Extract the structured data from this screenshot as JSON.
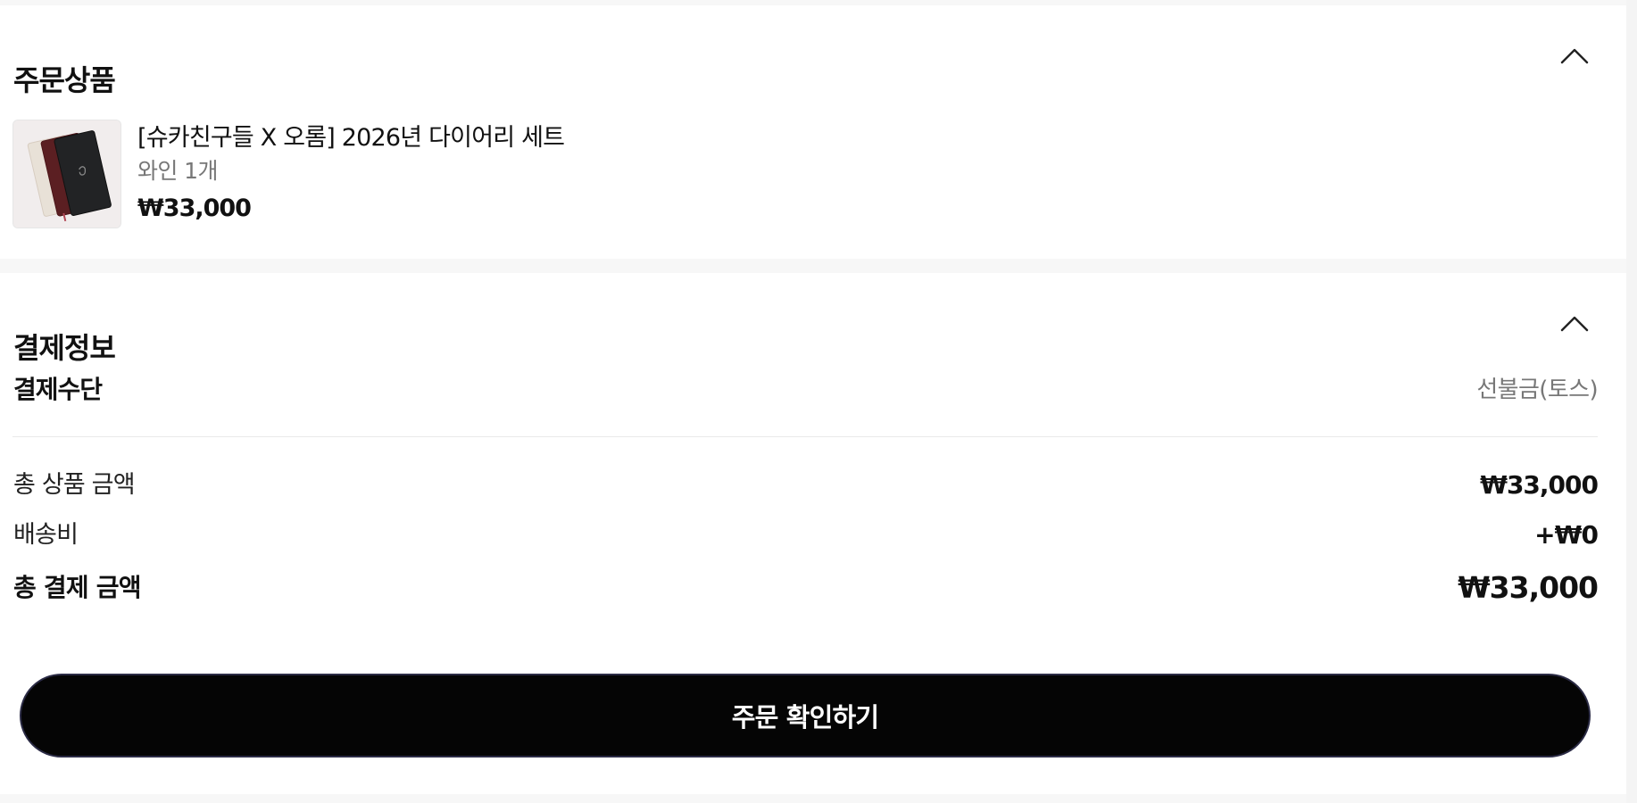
{
  "order_section": {
    "title": "주문상품",
    "toggle_icon": "chevron-up-icon",
    "item": {
      "thumbnail": "diary-set-product-image",
      "name": "[슈카친구들 X 오롬] 2026년 다이어리 세트",
      "option": "와인 1개",
      "price": "₩33,000"
    }
  },
  "payment_section": {
    "title": "결제정보",
    "toggle_icon": "chevron-up-icon",
    "method": {
      "label": "결제수단",
      "value": "선불금(토스)"
    },
    "summary": [
      {
        "label": "총 상품 금액",
        "value": "₩33,000"
      },
      {
        "label": "배송비",
        "value": "+₩0"
      },
      {
        "label": "총 결제 금액",
        "value": "₩33,000"
      }
    ]
  },
  "confirm_button": {
    "label": "주문 확인하기"
  },
  "colors": {
    "background": "#f7f7f7",
    "panel": "#ffffff",
    "primary_button": "#050505",
    "muted_text": "#777777"
  }
}
